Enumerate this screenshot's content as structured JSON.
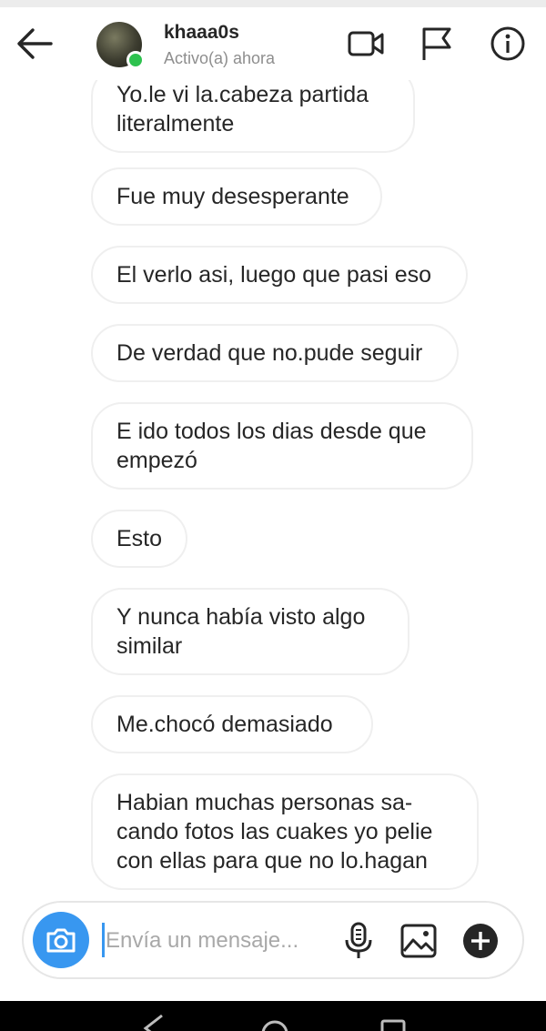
{
  "header": {
    "username": "khaaa0s",
    "presence": "Activo(a) ahora"
  },
  "icons": {
    "back": "arrow-left-icon",
    "video": "video-camera-icon",
    "flag": "flag-icon",
    "info": "info-icon",
    "camera": "camera-icon",
    "mic": "microphone-icon",
    "gallery": "image-icon",
    "plus": "plus-icon"
  },
  "colors": {
    "accent": "#3897f0",
    "online": "#2ec24f",
    "bubble_border": "#efefef"
  },
  "messages": [
    "Yo.le vi la.cabeza partida\nliteralmente",
    "Fue muy desesperante",
    "El verlo asi, luego que pasi eso",
    "De verdad que no.pude seguir",
    "E ido todos los dias desde que\nempezó",
    "Esto",
    "Y nunca había visto algo\nsimilar",
    "Me.chocó demasiado",
    "Habian muchas personas sa-\ncando fotos las cuakes yo pelie\ncon ellas para que no lo.hagan"
  ],
  "composer": {
    "placeholder": "Envía un mensaje..."
  }
}
